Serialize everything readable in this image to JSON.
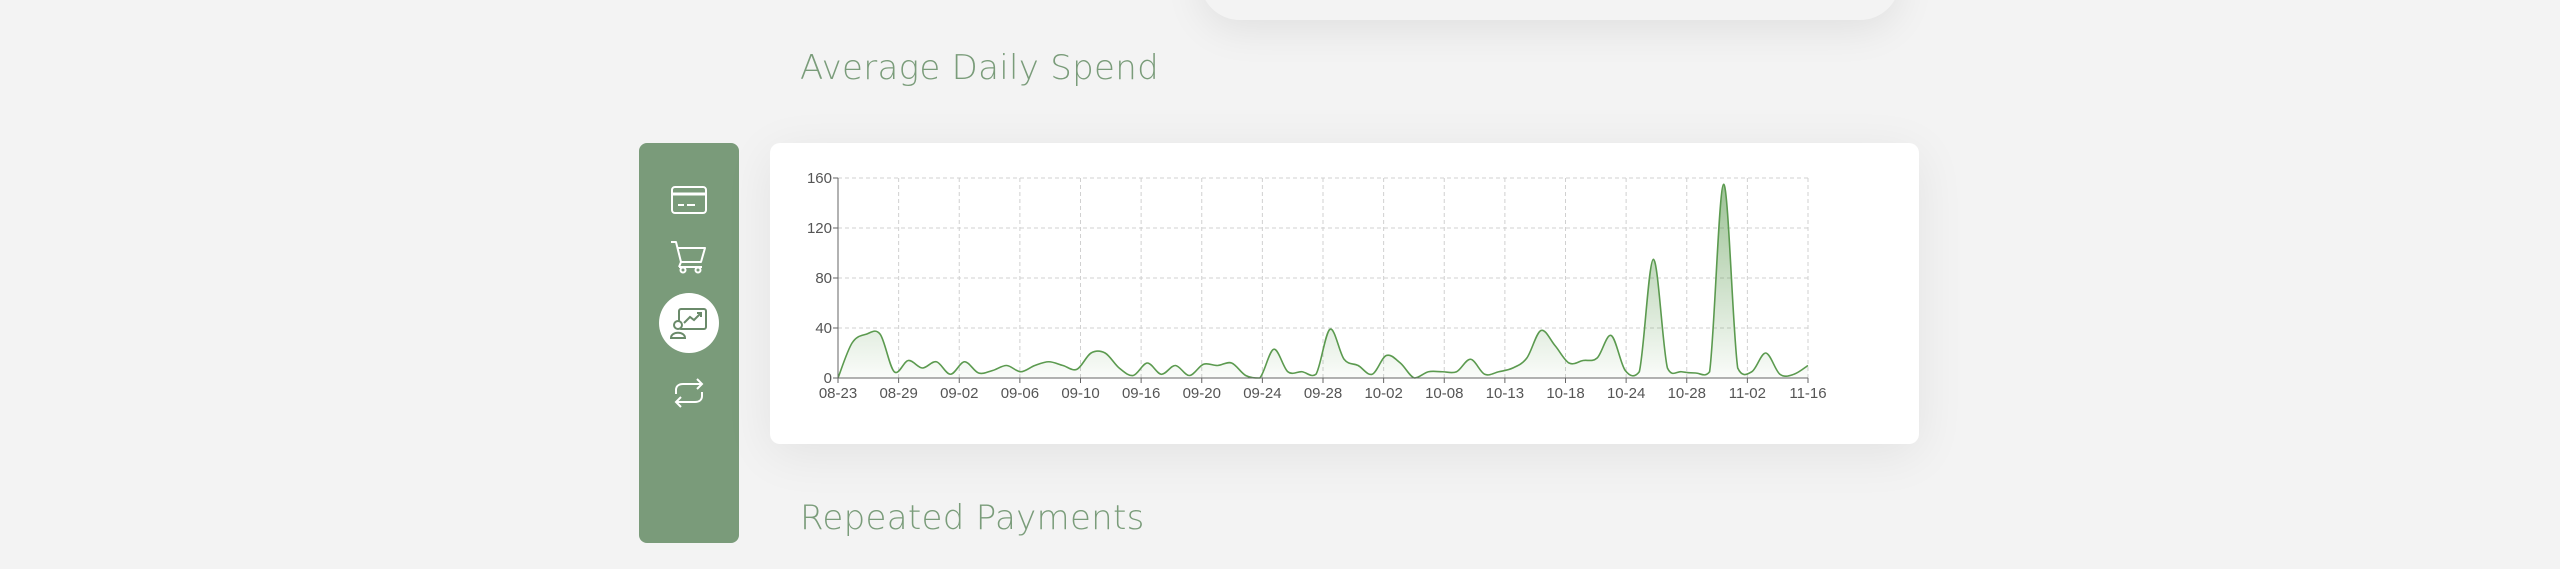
{
  "sections": {
    "spend_title": "Average Daily Spend",
    "repeat_title": "Repeated Payments"
  },
  "sidebar": {
    "items": [
      {
        "icon": "credit-card-icon",
        "active": false
      },
      {
        "icon": "shopping-cart-icon",
        "active": false
      },
      {
        "icon": "analytics-icon",
        "active": true
      },
      {
        "icon": "repeat-icon",
        "active": false
      }
    ],
    "color": "#7a9b7a"
  },
  "colors": {
    "accent": "#7a9c7a",
    "line": "#5b9a4f",
    "grid": "#d0d0d0"
  },
  "chart_data": {
    "type": "area",
    "title": "",
    "xlabel": "",
    "ylabel": "",
    "ylim": [
      0,
      160
    ],
    "yticks": [
      0,
      40,
      80,
      120,
      160
    ],
    "grid": true,
    "x_tick_labels": [
      "08-23",
      "08-29",
      "09-02",
      "09-06",
      "09-10",
      "09-16",
      "09-20",
      "09-24",
      "09-28",
      "10-02",
      "10-08",
      "10-13",
      "10-18",
      "10-24",
      "10-28",
      "11-02",
      "11-16"
    ],
    "series": [
      {
        "values": [
          0,
          28,
          35,
          35,
          5,
          14,
          8,
          13,
          3,
          13,
          4,
          6,
          10,
          5,
          10,
          13,
          10,
          7,
          20,
          20,
          8,
          2,
          12,
          3,
          10,
          2,
          11,
          10,
          12,
          2,
          0,
          23,
          5,
          5,
          3,
          39,
          15,
          10,
          3,
          18,
          12,
          0,
          5,
          5,
          5,
          15,
          3,
          5,
          8,
          16,
          38,
          26,
          12,
          14,
          16,
          34,
          6,
          5,
          95,
          8,
          5,
          4,
          5,
          155,
          8,
          5,
          20,
          3,
          3,
          10
        ]
      }
    ]
  }
}
